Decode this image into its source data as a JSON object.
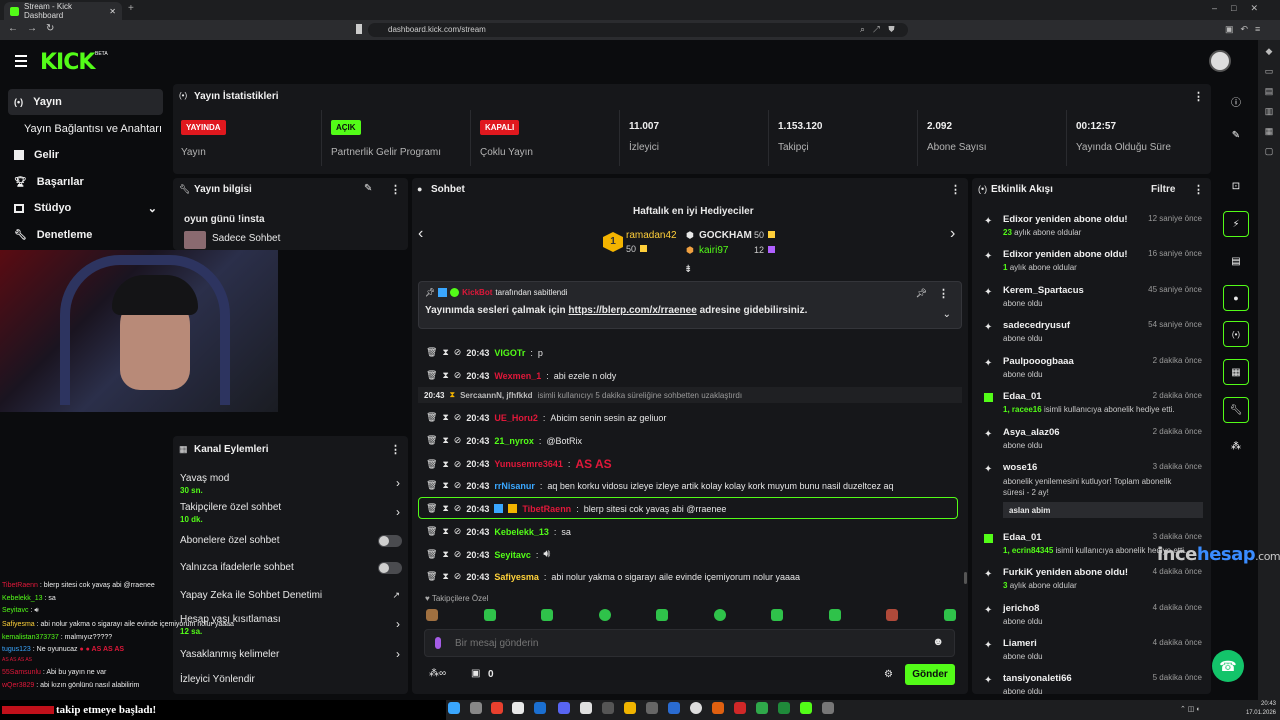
{
  "browser": {
    "tab_title": "Stream - Kick Dashboard",
    "url": "dashboard.kick.com/stream"
  },
  "header": {
    "logo": "KICK",
    "logo_sup": "BETA"
  },
  "nav": {
    "items": [
      {
        "label": "Yayın",
        "icon": "broadcast-icon"
      },
      {
        "label": "Yayın Bağlantısı ve Anahtarı",
        "icon": ""
      },
      {
        "label": "Gelir",
        "icon": "revenue-icon"
      },
      {
        "label": "Başarılar",
        "icon": "trophy-icon"
      },
      {
        "label": "Stüdyo",
        "icon": "studio-icon"
      },
      {
        "label": "Denetleme",
        "icon": "wrench-icon"
      }
    ]
  },
  "stats": {
    "title": "Yayın İstatistikleri",
    "cards": [
      {
        "badge": "YAYINDA",
        "label": "Yayın"
      },
      {
        "badge": "AÇIK",
        "label": "Partnerlik Gelir Programı"
      },
      {
        "badge": "KAPALI",
        "label": "Çoklu Yayın"
      },
      {
        "value": "11.007",
        "label": "İzleyici"
      },
      {
        "value": "1.153.120",
        "label": "Takipçi"
      },
      {
        "value": "2.092",
        "label": "Abone Sayısı"
      },
      {
        "value": "00:12:57",
        "label": "Yayında Olduğu Süre"
      }
    ],
    "colors": {
      "live": "#e0181e",
      "on": "#53fc18",
      "off": "#e0181e"
    }
  },
  "stream_info": {
    "title": "Yayın bilgisi",
    "stream_title": "oyun günü !insta",
    "category": "Sadece Sohbet"
  },
  "channel_actions": {
    "title": "Kanal Eylemleri",
    "items": [
      {
        "label": "Yavaş mod",
        "sub": "30 sn."
      },
      {
        "label": "Takipçilere özel sohbet",
        "sub": "10 dk."
      },
      {
        "label": "Abonelere özel sohbet",
        "sub": ""
      },
      {
        "label": "Yalnızca ifadelerle sohbet",
        "sub": ""
      },
      {
        "label": "Yapay Zeka ile Sohbet Denetimi",
        "sub": ""
      },
      {
        "label": "Hesap yaşı kısıtlaması",
        "sub": "12 sa."
      },
      {
        "label": "Yasaklanmış kelimeler",
        "sub": ""
      },
      {
        "label": "İzleyici Yönlendir",
        "sub": ""
      }
    ]
  },
  "chat": {
    "title": "Sohbet",
    "gifters_title": "Haftalık en iyi Hediyeciler",
    "gifters": [
      {
        "name": "ramadan42",
        "count": "50"
      },
      {
        "name": "GOCKHAM",
        "count": "50"
      },
      {
        "name": "kairi97",
        "count": "12"
      }
    ],
    "pinned_by_user": "KickBot",
    "pinned_by_suffix": "tarafından sabitlendi",
    "pinned_text_prefix": "Yayınımda sesleri çalmak için",
    "pinned_link": "https://blerp.com/x/rraenee",
    "pinned_text_suffix": "adresine gidebilirsiniz.",
    "messages": [
      {
        "time": "20:43",
        "user": "VIGOTr",
        "color": "#53fc18",
        "text": "p"
      },
      {
        "time": "20:43",
        "user": "Wexmen_1",
        "color": "#e0183a",
        "text": "abi ezele n oldy"
      },
      {
        "time": "20:43",
        "user": "UE_Horu2",
        "color": "#e0183a",
        "text": "Abicim senin sesin az geliuor"
      },
      {
        "time": "20:43",
        "user": "21_nyrox",
        "color": "#53fc18",
        "text": "@BotRix"
      },
      {
        "time": "20:43",
        "user": "Yunusemre3641",
        "color": "#e0183a",
        "text": "AS AS"
      },
      {
        "time": "20:43",
        "user": "rrNisanur",
        "color": "#3aa7ff",
        "text": "aq ben korku vidosu izleye izleye artik kolay kolay kork muyum bunu nasil duzeltcez aq"
      },
      {
        "time": "20:43",
        "user": "TibetRaenn",
        "color": "#e0183a",
        "text": "blerp sitesi cok yavaş abi @rraenee"
      },
      {
        "time": "20:43",
        "user": "Kebelekk_13",
        "color": "#53fc18",
        "text": "sa"
      },
      {
        "time": "20:43",
        "user": "Seyitavc",
        "color": "#53fc18",
        "text": ""
      },
      {
        "time": "20:43",
        "user": "Safiyesma",
        "color": "#ffd23a",
        "text": "abi nolur yakma o sigarayı aile evinde içemiyorum nolur yaaaa"
      }
    ],
    "system_time": "20:43",
    "system_text_users": "SercaannN, jfhfkkd",
    "system_text": "isimli kullanıcıyı 5 dakika süreliğine sohbetten uzaklaştırdı",
    "emote_section": "Takipçilere Özel",
    "input_placeholder": "Bir mesaj gönderin",
    "points": "0",
    "send_label": "Gönder"
  },
  "activity": {
    "title": "Etkinlik Akışı",
    "filter_label": "Filtre",
    "items": [
      {
        "name": "Edixor yeniden abone oldu!",
        "sub_hl": "23",
        "sub": "aylık abone oldular",
        "time": "12 saniye önce"
      },
      {
        "name": "Edixor yeniden abone oldu!",
        "sub_hl": "1",
        "sub": "aylık abone oldular",
        "time": "16 saniye önce"
      },
      {
        "name": "Kerem_Spartacus",
        "sub_hl": "",
        "sub": "abone oldu",
        "time": "45 saniye önce"
      },
      {
        "name": "sadecedryusuf",
        "sub_hl": "",
        "sub": "abone oldu",
        "time": "54 saniye önce"
      },
      {
        "name": "Paulpooogbaaa",
        "sub_hl": "",
        "sub": "abone oldu",
        "time": "2 dakika önce"
      },
      {
        "name": "Edaa_01",
        "sub_hl": "1, racee16",
        "sub": "isimli kullanıcıya abonelik hediye etti.",
        "time": "2 dakika önce"
      },
      {
        "name": "Asya_alaz06",
        "sub_hl": "",
        "sub": "abone oldu",
        "time": "2 dakika önce"
      },
      {
        "name": "wose16",
        "sub_hl": "",
        "sub": "abonelik yenilemesini kutluyor! Toplam abonelik süresi - 2 ay!",
        "time": "3 dakika önce",
        "message": "aslan abim"
      },
      {
        "name": "Edaa_01",
        "sub_hl": "1, ecrin84345",
        "sub": "isimli kullanıcıya abonelik hediye etti.",
        "time": "3 dakika önce"
      },
      {
        "name": "FurkiK yeniden abone oldu!",
        "sub_hl": "3",
        "sub": "aylık abone oldular",
        "time": "4 dakika önce"
      },
      {
        "name": "jericho8",
        "sub_hl": "",
        "sub": "abone oldu",
        "time": "4 dakika önce"
      },
      {
        "name": "Liameri",
        "sub_hl": "",
        "sub": "abone oldu",
        "time": "4 dakika önce"
      },
      {
        "name": "tansiyonaleti66",
        "sub_hl": "",
        "sub": "abone oldu",
        "time": "5 dakika önce"
      }
    ]
  },
  "overlay_chat": [
    {
      "user": "TibetRaenn",
      "color": "#e0183a",
      "text": "blerp sitesi cok yavaş abi @rraenee"
    },
    {
      "user": "Kebelekk_13",
      "color": "#53fc18",
      "text": "sa"
    },
    {
      "user": "Seyitavc",
      "color": "#53fc18",
      "text": ""
    },
    {
      "user": "Safiyesma",
      "color": "#ffd23a",
      "text": "abi nolur yakma o sigarayı aile evinde içemiyorum nolur yaaaa"
    },
    {
      "user": "kemalistan373737",
      "color": "#53fc18",
      "text": "malmıyız?????"
    },
    {
      "user": "tugus123",
      "color": "#3aa7ff",
      "text": "Ne oyunucaz"
    },
    {
      "user": "55Samsunlu",
      "color": "#e0183a",
      "text": "Abi bu yayın ne var"
    },
    {
      "user": "wQer3829",
      "color": "#e0183a",
      "text": "abi kızın gönlünü nasıl alabilirim"
    }
  ],
  "follow_notice": "takip etmeye başladı!",
  "watermark": {
    "part1": "ince",
    "part2": "hesap",
    "part3": ".com"
  },
  "taskbar": {
    "time": "20:43",
    "date": "17.01.2026"
  }
}
